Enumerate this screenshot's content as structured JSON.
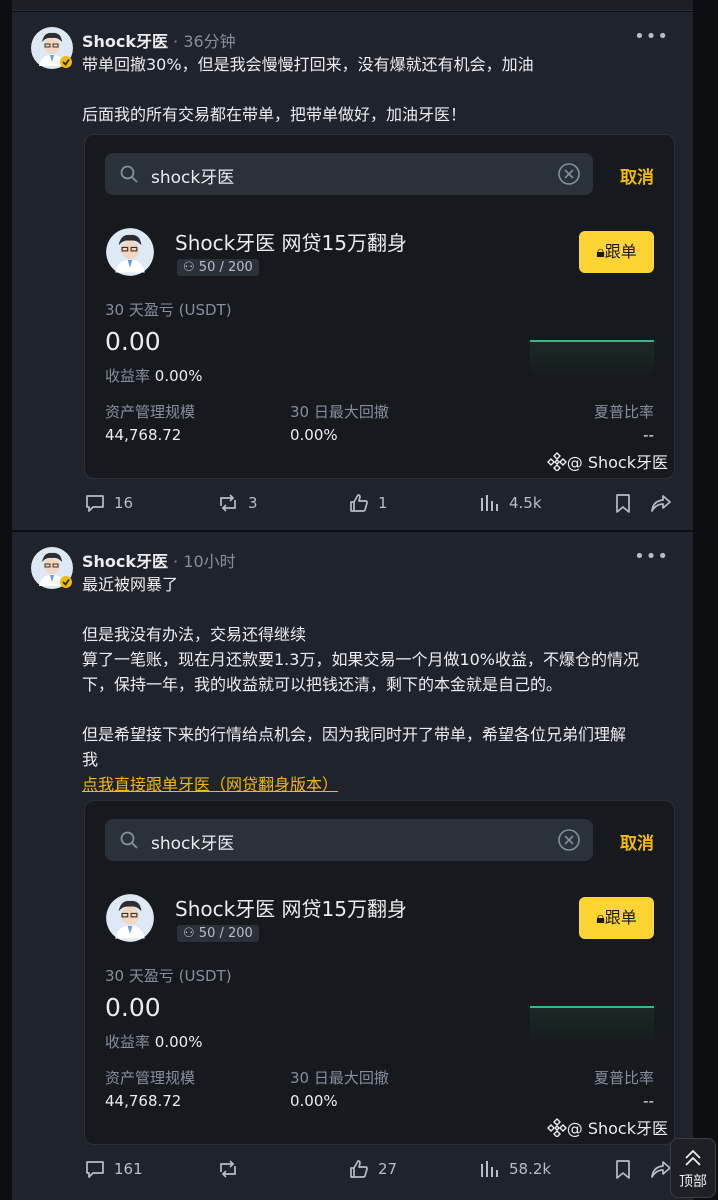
{
  "posts": [
    {
      "author": "Shock牙医",
      "time": "· 36分钟",
      "lines": [
        "带单回撤30%，但是我会慢慢打回来，没有爆就还有机会，加油",
        "",
        "后面我的所有交易都在带单，把带单做好，加油牙医！"
      ],
      "card": {
        "search_text": "shock牙医",
        "cancel": "取消",
        "title": "Shock牙医 网贷15万翻身",
        "members": "50 / 200",
        "follow": "跟单",
        "pnl_label": "30 天盈亏 (USDT)",
        "pnl_value": "0.00",
        "roi_label": "收益率",
        "roi_value": "0.00%",
        "aum_label": "资产管理规模",
        "aum_value": "44,768.72",
        "mdd_label": "30 日最大回撤",
        "mdd_value": "0.00%",
        "sharpe_label": "夏普比率",
        "sharpe_value": "--",
        "watermark": "@ Shock牙医"
      },
      "stats": {
        "comments": "16",
        "reposts": "3",
        "likes": "1",
        "views": "4.5k"
      }
    },
    {
      "author": "Shock牙医",
      "time": "· 10小时",
      "lines": [
        "最近被网暴了",
        "",
        "但是我没有办法，交易还得继续",
        "算了一笔账，现在月还款要1.3万，如果交易一个月做10%收益，不爆仓的情况",
        "下，保持一年，我的收益就可以把钱还清，剩下的本金就是自己的。",
        "",
        "但是希望接下来的行情给点机会，因为我同时开了带单，希望各位兄弟们理解",
        "我"
      ],
      "link": "点我直接跟单牙医（网贷翻身版本）",
      "card": {
        "search_text": "shock牙医",
        "cancel": "取消",
        "title": "Shock牙医 网贷15万翻身",
        "members": "50 / 200",
        "follow": "跟单",
        "pnl_label": "30 天盈亏 (USDT)",
        "pnl_value": "0.00",
        "roi_label": "收益率",
        "roi_value": "0.00%",
        "aum_label": "资产管理规模",
        "aum_value": "44,768.72",
        "mdd_label": "30 日最大回撤",
        "mdd_value": "0.00%",
        "sharpe_label": "夏普比率",
        "sharpe_value": "--",
        "watermark": "@ Shock牙医"
      },
      "stats": {
        "comments": "161",
        "reposts": "",
        "likes": "27",
        "views": "58.2k"
      }
    }
  ],
  "back_to_top": "顶部",
  "colors": {
    "accent": "#f0b90b",
    "follow_button": "#fcd535",
    "positive": "#2ebd85",
    "background": "#1f232b"
  }
}
